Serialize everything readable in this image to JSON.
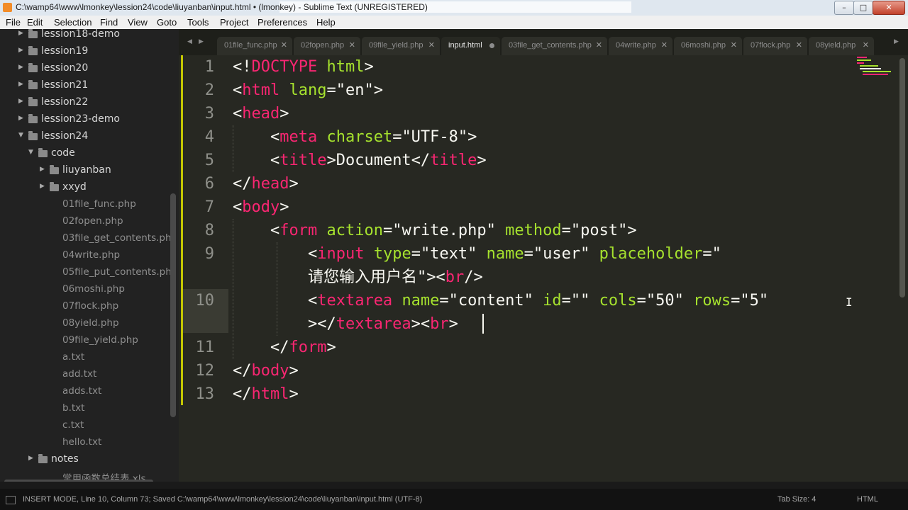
{
  "window": {
    "title": "C:\\wamp64\\www\\lmonkey\\lession24\\code\\liuyanban\\input.html • (lmonkey) - Sublime Text (UNREGISTERED)",
    "minimize": "–",
    "maximize": "□",
    "close": "✕"
  },
  "menu": {
    "items": [
      "File",
      "Edit",
      "Selection",
      "Find",
      "View",
      "Goto",
      "Tools",
      "Project",
      "Preferences",
      "Help"
    ]
  },
  "sidebar": {
    "items": [
      {
        "label": "lession18-demo",
        "kind": "folder",
        "expanded": false
      },
      {
        "label": "lession19",
        "kind": "folder",
        "expanded": false
      },
      {
        "label": "lession20",
        "kind": "folder",
        "expanded": false
      },
      {
        "label": "lession21",
        "kind": "folder",
        "expanded": false
      },
      {
        "label": "lession22",
        "kind": "folder",
        "expanded": false
      },
      {
        "label": "lession23-demo",
        "kind": "folder",
        "expanded": false
      },
      {
        "label": "lession24",
        "kind": "folder",
        "expanded": true
      },
      {
        "label": "code",
        "kind": "folder",
        "expanded": true
      },
      {
        "label": "liuyanban",
        "kind": "folder",
        "expanded": false
      },
      {
        "label": "xxyd",
        "kind": "folder",
        "expanded": false
      },
      {
        "label": "01file_func.php",
        "kind": "file"
      },
      {
        "label": "02fopen.php",
        "kind": "file"
      },
      {
        "label": "03file_get_contents.ph",
        "kind": "file"
      },
      {
        "label": "04write.php",
        "kind": "file"
      },
      {
        "label": "05file_put_contents.ph",
        "kind": "file"
      },
      {
        "label": "06moshi.php",
        "kind": "file"
      },
      {
        "label": "07flock.php",
        "kind": "file"
      },
      {
        "label": "08yield.php",
        "kind": "file"
      },
      {
        "label": "09file_yield.php",
        "kind": "file"
      },
      {
        "label": "a.txt",
        "kind": "file"
      },
      {
        "label": "add.txt",
        "kind": "file"
      },
      {
        "label": "adds.txt",
        "kind": "file"
      },
      {
        "label": "b.txt",
        "kind": "file"
      },
      {
        "label": "c.txt",
        "kind": "file"
      },
      {
        "label": "hello.txt",
        "kind": "file"
      },
      {
        "label": "notes",
        "kind": "folder",
        "expanded": false
      },
      {
        "label": "常用函数总结表.xls",
        "kind": "file"
      }
    ]
  },
  "tabs": {
    "prev": "◀",
    "next": "▶",
    "items": [
      {
        "label": "01file_func.php",
        "active": false
      },
      {
        "label": "02fopen.php",
        "active": false
      },
      {
        "label": "09file_yield.php",
        "active": false
      },
      {
        "label": "input.html",
        "active": true,
        "modified": true
      },
      {
        "label": "03file_get_contents.php",
        "active": false
      },
      {
        "label": "04write.php",
        "active": false
      },
      {
        "label": "06moshi.php",
        "active": false
      },
      {
        "label": "07flock.php",
        "active": false
      },
      {
        "label": "08yield.php",
        "active": false
      }
    ],
    "close_glyph": "✕"
  },
  "editor": {
    "lines": [
      {
        "n": "1",
        "tokens": [
          [
            "br",
            "<!"
          ],
          [
            "tag",
            "DOCTYPE"
          ],
          [
            "br",
            " "
          ],
          [
            "attr",
            "html"
          ],
          [
            "br",
            ">"
          ]
        ]
      },
      {
        "n": "2",
        "tokens": [
          [
            "br",
            "<"
          ],
          [
            "tag",
            "html"
          ],
          [
            "br",
            " "
          ],
          [
            "attr",
            "lang"
          ],
          [
            "br",
            "="
          ],
          [
            "str",
            "\"en\""
          ],
          [
            "br",
            ">"
          ]
        ]
      },
      {
        "n": "3",
        "tokens": [
          [
            "br",
            "<"
          ],
          [
            "tag",
            "head"
          ],
          [
            "br",
            ">"
          ]
        ]
      },
      {
        "n": "4",
        "tokens": [
          [
            "br",
            "    <"
          ],
          [
            "tag",
            "meta"
          ],
          [
            "br",
            " "
          ],
          [
            "attr",
            "charset"
          ],
          [
            "br",
            "="
          ],
          [
            "str",
            "\"UTF-8\""
          ],
          [
            "br",
            ">"
          ]
        ]
      },
      {
        "n": "5",
        "tokens": [
          [
            "br",
            "    <"
          ],
          [
            "tag",
            "title"
          ],
          [
            "br",
            ">"
          ],
          [
            "txt",
            "Document"
          ],
          [
            "br",
            "</"
          ],
          [
            "tag",
            "title"
          ],
          [
            "br",
            ">"
          ]
        ]
      },
      {
        "n": "6",
        "tokens": [
          [
            "br",
            "</"
          ],
          [
            "tag",
            "head"
          ],
          [
            "br",
            ">"
          ]
        ]
      },
      {
        "n": "7",
        "tokens": [
          [
            "br",
            "<"
          ],
          [
            "tag",
            "body"
          ],
          [
            "br",
            ">"
          ]
        ]
      },
      {
        "n": "8",
        "tokens": [
          [
            "br",
            "    <"
          ],
          [
            "tag",
            "form"
          ],
          [
            "br",
            " "
          ],
          [
            "attr",
            "action"
          ],
          [
            "br",
            "="
          ],
          [
            "str",
            "\"write.php\""
          ],
          [
            "br",
            " "
          ],
          [
            "attr",
            "method"
          ],
          [
            "br",
            "="
          ],
          [
            "str",
            "\"post\""
          ],
          [
            "br",
            ">"
          ]
        ]
      },
      {
        "n": "9",
        "tokens": [
          [
            "br",
            "        <"
          ],
          [
            "tag",
            "input"
          ],
          [
            "br",
            " "
          ],
          [
            "attr",
            "type"
          ],
          [
            "br",
            "="
          ],
          [
            "str",
            "\"text\""
          ],
          [
            "br",
            " "
          ],
          [
            "attr",
            "name"
          ],
          [
            "br",
            "="
          ],
          [
            "str",
            "\"user\""
          ],
          [
            "br",
            " "
          ],
          [
            "attr",
            "placeholder"
          ],
          [
            "br",
            "="
          ],
          [
            "str",
            "\""
          ]
        ]
      },
      {
        "n": "",
        "tokens": [
          [
            "str",
            "        请您输入用户名\""
          ],
          [
            "br",
            "><"
          ],
          [
            "tag",
            "br"
          ],
          [
            "br",
            "/>"
          ]
        ]
      },
      {
        "n": "10",
        "tokens": [
          [
            "br",
            "        <"
          ],
          [
            "tag",
            "textarea"
          ],
          [
            "br",
            " "
          ],
          [
            "attr",
            "name"
          ],
          [
            "br",
            "="
          ],
          [
            "str",
            "\"content\""
          ],
          [
            "br",
            " "
          ],
          [
            "attr",
            "id"
          ],
          [
            "br",
            "="
          ],
          [
            "str",
            "\"\""
          ],
          [
            "br",
            " "
          ],
          [
            "attr",
            "cols"
          ],
          [
            "br",
            "="
          ],
          [
            "str",
            "\"50\""
          ],
          [
            "br",
            " "
          ],
          [
            "attr",
            "rows"
          ],
          [
            "br",
            "="
          ],
          [
            "str",
            "\"5\""
          ]
        ]
      },
      {
        "n": "",
        "tokens": [
          [
            "br",
            "        ></"
          ],
          [
            "tag",
            "textarea"
          ],
          [
            "br",
            "><"
          ],
          [
            "tag",
            "br"
          ],
          [
            "br",
            ">"
          ]
        ]
      },
      {
        "n": "11",
        "tokens": [
          [
            "br",
            "    </"
          ],
          [
            "tag",
            "form"
          ],
          [
            "br",
            ">"
          ]
        ]
      },
      {
        "n": "12",
        "tokens": [
          [
            "br",
            "</"
          ],
          [
            "tag",
            "body"
          ],
          [
            "br",
            ">"
          ]
        ]
      },
      {
        "n": "13",
        "tokens": [
          [
            "br",
            "</"
          ],
          [
            "tag",
            "html"
          ],
          [
            "br",
            ">"
          ]
        ]
      }
    ],
    "ibeam": "I"
  },
  "status": {
    "text": "INSERT MODE, Line 10, Column 73; Saved C:\\wamp64\\www\\lmonkey\\lession24\\code\\liuyanban\\input.html (UTF-8)",
    "tab_size": "Tab Size: 4",
    "syntax": "HTML"
  },
  "colors": {
    "editor_bg": "#272822",
    "tag": "#f92672",
    "attribute": "#a6e22e",
    "text": "#f8f8f2",
    "gutter_text": "#8f908a",
    "sidebar_bg": "#222222"
  }
}
